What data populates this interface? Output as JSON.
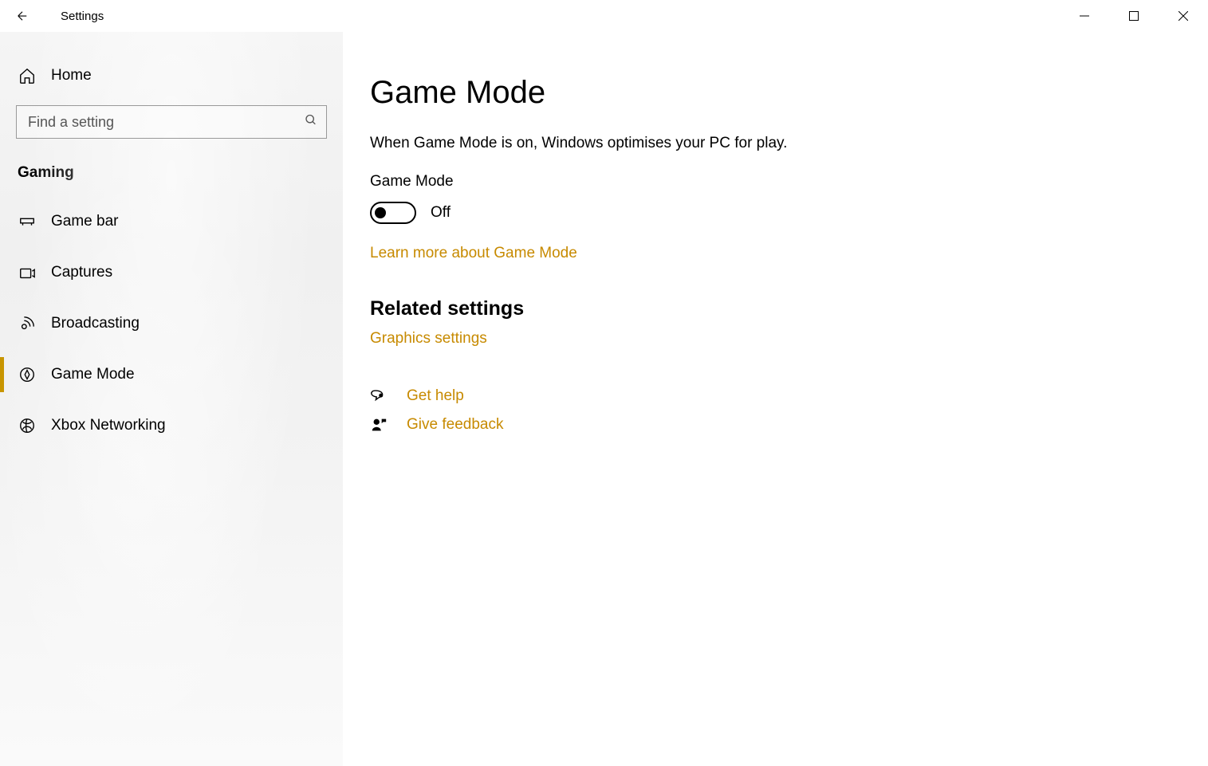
{
  "window": {
    "title": "Settings"
  },
  "sidebar": {
    "home_label": "Home",
    "search_placeholder": "Find a setting",
    "section_header": "Gaming",
    "items": [
      {
        "label": "Game bar"
      },
      {
        "label": "Captures"
      },
      {
        "label": "Broadcasting"
      },
      {
        "label": "Game Mode"
      },
      {
        "label": "Xbox Networking"
      }
    ]
  },
  "content": {
    "title": "Game Mode",
    "description": "When Game Mode is on, Windows optimises your PC for play.",
    "toggle_label": "Game Mode",
    "toggle_state": "Off",
    "learn_more": "Learn more about Game Mode",
    "related_heading": "Related settings",
    "graphics_link": "Graphics settings",
    "help_links": [
      {
        "label": "Get help"
      },
      {
        "label": "Give feedback"
      }
    ]
  }
}
